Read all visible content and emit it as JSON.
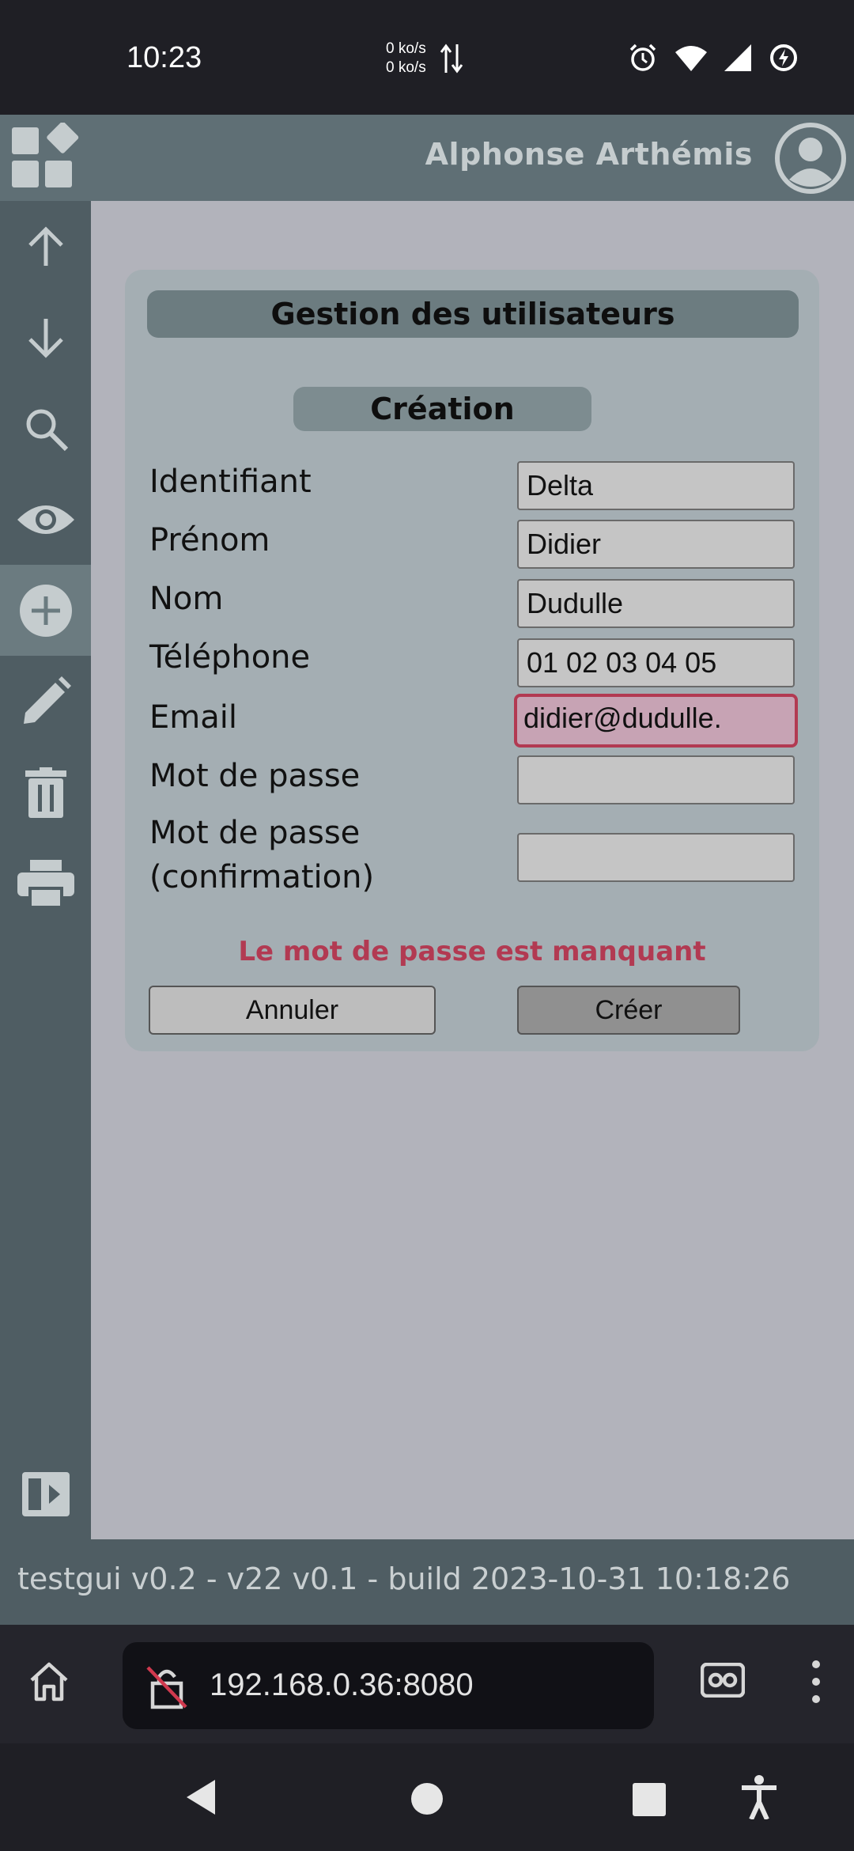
{
  "status_bar": {
    "time": "10:23",
    "net_up": "0 ko/s",
    "net_down": "0 ko/s",
    "icons": [
      "alarm-icon",
      "wifi-icon",
      "signal-icon",
      "battery-saver-icon"
    ]
  },
  "header": {
    "user_name": "Alphonse Arthémis",
    "logo_icon": "grid-apps-icon",
    "avatar_icon": "user-circle-icon"
  },
  "sidebar": {
    "items": [
      {
        "icon": "arrow-up-icon",
        "active": false
      },
      {
        "icon": "arrow-down-icon",
        "active": false
      },
      {
        "icon": "search-icon",
        "active": false
      },
      {
        "icon": "eye-icon",
        "active": false
      },
      {
        "icon": "add-circle-icon",
        "active": true
      },
      {
        "icon": "pencil-icon",
        "active": false
      },
      {
        "icon": "trash-icon",
        "active": false
      },
      {
        "icon": "printer-icon",
        "active": false
      }
    ],
    "bottom_icon": "collapse-panel-icon"
  },
  "form": {
    "title": "Gestion des utilisateurs",
    "subtitle": "Création",
    "fields": [
      {
        "label": "Identifiant",
        "value": "Delta"
      },
      {
        "label": "Prénom",
        "value": "Didier"
      },
      {
        "label": "Nom",
        "value": "Dudulle"
      },
      {
        "label": "Téléphone",
        "value": "01 02 03 04 05"
      },
      {
        "label": "Email",
        "value": "didier@dudulle."
      },
      {
        "label": "Mot de passe",
        "value": ""
      },
      {
        "label_line1": "Mot de passe",
        "label_line2": "(confirmation)",
        "value": ""
      }
    ],
    "error": "Le mot de passe est manquant",
    "cancel_label": "Annuler",
    "create_label": "Créer"
  },
  "footer": {
    "version": "testgui v0.2 - v22 v0.1 - build 2023-10-31 10:18:26"
  },
  "browser": {
    "url": "192.168.0.36:8080"
  },
  "colors": {
    "sidebar": "#4f5d63",
    "header": "#5f6f75",
    "content": "#b2b3bb",
    "panel": "#a4aeb3",
    "error": "#b23a52"
  }
}
